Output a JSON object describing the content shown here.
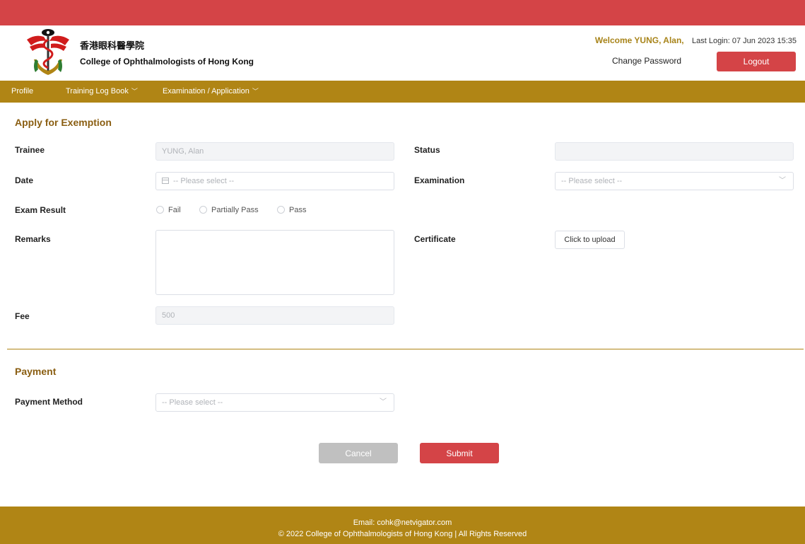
{
  "header": {
    "org_name_zh": "香港眼科醫學院",
    "org_name_en": "College of Ophthalmologists of Hong Kong",
    "welcome": "Welcome YUNG, Alan,",
    "last_login": "Last Login: 07 Jun 2023 15:35",
    "change_password": "Change Password",
    "logout": "Logout"
  },
  "nav": {
    "items": [
      {
        "label": "Profile"
      },
      {
        "label": "Training Log Book"
      },
      {
        "label": "Examination / Application"
      }
    ]
  },
  "form": {
    "title": "Apply for Exemption",
    "trainee_label": "Trainee",
    "trainee_value": "YUNG, Alan",
    "status_label": "Status",
    "status_value": "",
    "date_label": "Date",
    "date_placeholder": "-- Please select --",
    "examination_label": "Examination",
    "examination_placeholder": "-- Please select --",
    "exam_result_label": "Exam Result",
    "exam_result_options": [
      "Fail",
      "Partially Pass",
      "Pass"
    ],
    "remarks_label": "Remarks",
    "certificate_label": "Certificate",
    "upload_label": "Click to upload",
    "fee_label": "Fee",
    "fee_value": "500"
  },
  "payment": {
    "title": "Payment",
    "method_label": "Payment Method",
    "method_placeholder": "-- Please select --"
  },
  "actions": {
    "cancel": "Cancel",
    "submit": "Submit"
  },
  "footer": {
    "email": "Email: cohk@netvigator.com",
    "copyright": "© 2022 College of Ophthalmologists of Hong Kong | All Rights Reserved"
  },
  "colors": {
    "brand_red": "#d44447",
    "brand_gold": "#b08515",
    "title_brown": "#8a5e12"
  },
  "icons": {
    "logo": "college-crest-logo",
    "calendar": "calendar-icon",
    "dropdown": "chevron-down-icon"
  }
}
